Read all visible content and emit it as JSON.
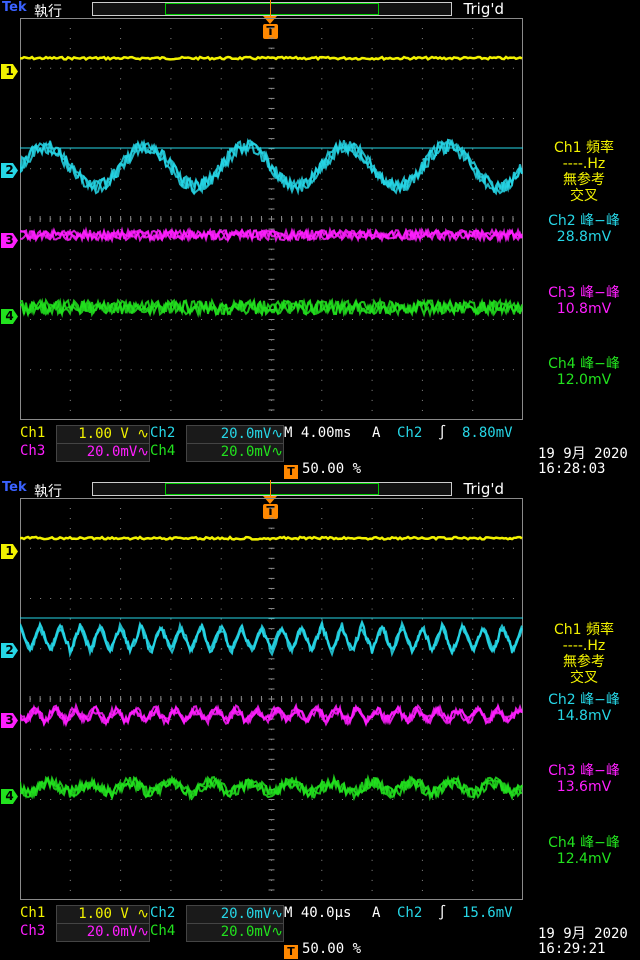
{
  "colors": {
    "ch1": "#f2f200",
    "ch2": "#26d6e6",
    "ch3": "#ff1fff",
    "ch4": "#22e21e",
    "trigger": "#ff8c00",
    "grid": "#8a8a8a",
    "brand": "#3a62ff"
  },
  "panels": [
    {
      "brand": "Tek",
      "status": "執行",
      "trig_state": "Trig'd",
      "trigger_marker": "T",
      "channels": [
        {
          "label": "1",
          "level": 0.1
        },
        {
          "label": "2",
          "level": 0.37
        },
        {
          "label": "3",
          "level": 0.54
        },
        {
          "label": "4",
          "level": 0.72
        }
      ],
      "ch2_wave": "sine",
      "ch2_cycles": 5,
      "measurements": [
        {
          "title": "Ch1 頻率",
          "line2": "----.Hz",
          "line3": "無参考",
          "line4": "交叉",
          "color": "ch1"
        },
        {
          "title": "Ch2 峰−峰",
          "line2": "28.8mV",
          "color": "ch2"
        },
        {
          "title": "Ch3 峰−峰",
          "line2": "10.8mV",
          "color": "ch3"
        },
        {
          "title": "Ch4 峰−峰",
          "line2": "12.0mV",
          "color": "ch4"
        }
      ],
      "row1": {
        "ch1": "Ch1",
        "ch1_scale": "1.00 V",
        "ch2": "Ch2",
        "ch2_scale": "20.0mV",
        "timebase": "M 4.00ms",
        "acq": "A",
        "trig_src": "Ch2",
        "trig_slope": "∫",
        "trig_level": "8.80mV"
      },
      "row2": {
        "ch3": "Ch3",
        "ch3_scale": "20.0mV",
        "ch4": "Ch4",
        "ch4_scale": "20.0mV"
      },
      "trig_pos": "50.00 %",
      "date": "19 9月  2020",
      "time": "16:28:03"
    },
    {
      "brand": "Tek",
      "status": "執行",
      "trig_state": "Trig'd",
      "trigger_marker": "T",
      "channels": [
        {
          "label": "1",
          "level": 0.1
        },
        {
          "label": "2",
          "level": 0.35
        },
        {
          "label": "3",
          "level": 0.54
        },
        {
          "label": "4",
          "level": 0.72
        }
      ],
      "ch2_wave": "triangle",
      "ch2_cycles": 25,
      "measurements": [
        {
          "title": "Ch1 頻率",
          "line2": "----.Hz",
          "line3": "無参考",
          "line4": "交叉",
          "color": "ch1"
        },
        {
          "title": "Ch2 峰−峰",
          "line2": "14.8mV",
          "color": "ch2"
        },
        {
          "title": "Ch3 峰−峰",
          "line2": "13.6mV",
          "color": "ch3"
        },
        {
          "title": "Ch4 峰−峰",
          "line2": "12.4mV",
          "color": "ch4"
        }
      ],
      "row1": {
        "ch1": "Ch1",
        "ch1_scale": "1.00 V",
        "ch2": "Ch2",
        "ch2_scale": "20.0mV",
        "timebase": "M 40.0µs",
        "acq": "A",
        "trig_src": "Ch2",
        "trig_slope": "∫",
        "trig_level": "15.6mV"
      },
      "row2": {
        "ch3": "Ch3",
        "ch3_scale": "20.0mV",
        "ch4": "Ch4",
        "ch4_scale": "20.0mV"
      },
      "trig_pos": "50.00 %",
      "date": "19 9月  2020",
      "time": "16:29:21"
    }
  ]
}
